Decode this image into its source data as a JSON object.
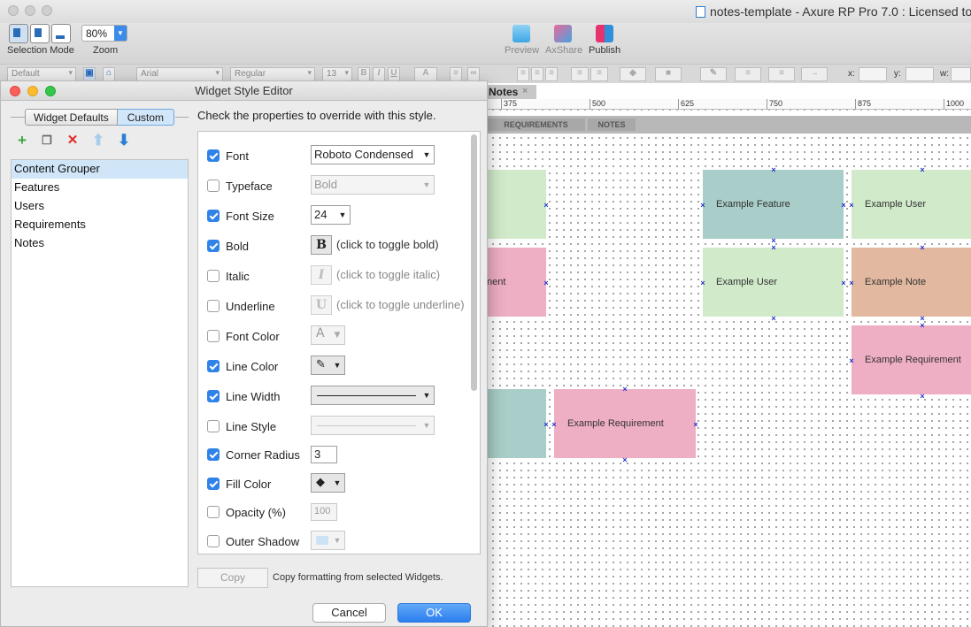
{
  "app": {
    "title": "notes-template - Axure RP Pro 7.0 : Licensed to"
  },
  "toolbar": {
    "selection_mode_label": "Selection Mode",
    "zoom_label": "Zoom",
    "zoom_value": "80%",
    "preview_label": "Preview",
    "axshare_label": "AxShare",
    "publish_label": "Publish"
  },
  "formatbar": {
    "style": "Default",
    "font": "Arial",
    "weight": "Regular",
    "size": "13",
    "bold": "B",
    "italic": "I",
    "underline": "U",
    "x_label": "x:",
    "y_label": "y:",
    "w_label": "w:"
  },
  "canvas": {
    "tab_label": "Notes",
    "tab_close": "×",
    "ruler": [
      "375",
      "500",
      "625",
      "750",
      "875",
      "1000"
    ],
    "header_tabs": [
      "REQUIREMENTS",
      "NOTES"
    ],
    "cards": [
      {
        "label": ""
      },
      {
        "label": "Example Feature"
      },
      {
        "label": "Example User"
      },
      {
        "label": "nent"
      },
      {
        "label": "Example User"
      },
      {
        "label": "Example Note"
      },
      {
        "label": "Example Requirement"
      },
      {
        "label": ""
      },
      {
        "label": "Example Requirement"
      }
    ]
  },
  "dialog": {
    "title": "Widget Style Editor",
    "tabs": [
      "Widget Defaults",
      "Custom"
    ],
    "active_tab": "Custom",
    "instructions": "Check the properties to override with this style.",
    "styles": [
      "Content Grouper",
      "Features",
      "Users",
      "Requirements",
      "Notes"
    ],
    "selected_style": "Content Grouper",
    "properties": {
      "font": {
        "label": "Font",
        "checked": true,
        "value": "Roboto Condensed"
      },
      "typeface": {
        "label": "Typeface",
        "checked": false,
        "value": "Bold"
      },
      "font_size": {
        "label": "Font Size",
        "checked": true,
        "value": "24"
      },
      "bold": {
        "label": "Bold",
        "checked": true,
        "glyph": "B",
        "hint": "(click to toggle bold)"
      },
      "italic": {
        "label": "Italic",
        "checked": false,
        "glyph": "I",
        "hint": "(click to toggle italic)"
      },
      "underline": {
        "label": "Underline",
        "checked": false,
        "glyph": "U",
        "hint": "(click to toggle underline)"
      },
      "font_color": {
        "label": "Font Color",
        "checked": false,
        "glyph": "A"
      },
      "line_color": {
        "label": "Line Color",
        "checked": true
      },
      "line_width": {
        "label": "Line Width",
        "checked": true
      },
      "line_style": {
        "label": "Line Style",
        "checked": false
      },
      "corner_radius": {
        "label": "Corner Radius",
        "checked": true,
        "value": "3"
      },
      "fill_color": {
        "label": "Fill Color",
        "checked": true
      },
      "opacity": {
        "label": "Opacity (%)",
        "checked": false,
        "value": "100"
      },
      "outer_shadow": {
        "label": "Outer Shadow",
        "checked": false
      }
    },
    "copy_button": "Copy",
    "copy_hint": "Copy formatting from selected Widgets.",
    "cancel": "Cancel",
    "ok": "OK"
  },
  "colors": {
    "accent": "#2f83e8",
    "card_green": "#d1eaca",
    "card_teal": "#a9cdc8",
    "card_pink": "#eeaec4",
    "card_peach": "#e2b8a0",
    "selection_marker": "#2233cc"
  },
  "icons": {
    "add": "plus-icon",
    "duplicate": "duplicate-icon",
    "delete": "delete-icon",
    "move_up": "arrow-up-icon",
    "move_down": "arrow-down-icon"
  }
}
